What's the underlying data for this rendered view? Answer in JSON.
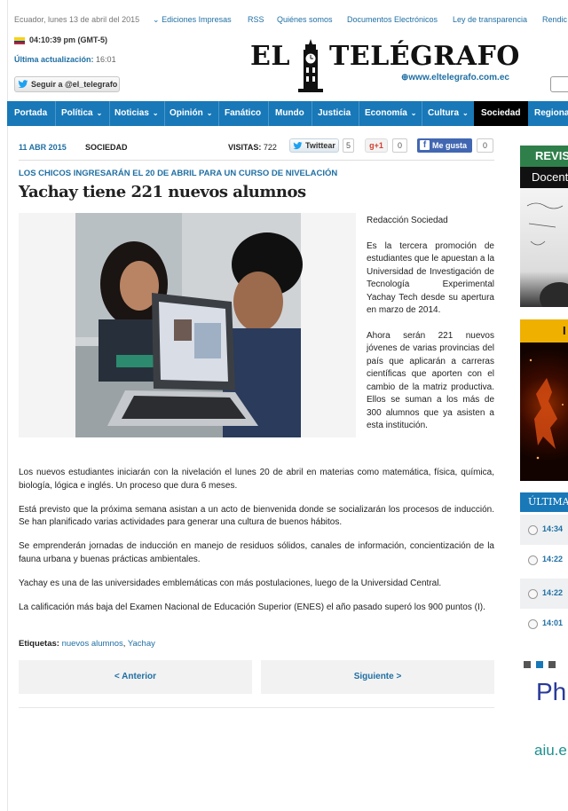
{
  "topbar": {
    "date": "Ecuador, lunes 13 de abril del 2015",
    "links": [
      "Ediciones Impresas",
      "RSS",
      "Quiénes somos",
      "Documentos Electrónicos",
      "Ley de transparencia",
      "Rendic"
    ]
  },
  "header": {
    "time": "04:10:39 pm (GMT-5)",
    "updated_label": "Última actualización:",
    "updated_value": "16:01",
    "follow_label": "Seguir a @el_telegrafo",
    "logo_left": "EL",
    "logo_right": "TELÉGRAFO",
    "logo_url": "www.eltelegrafo.com.ec"
  },
  "nav": {
    "items": [
      {
        "label": "Portada",
        "chevron": false
      },
      {
        "label": "Política",
        "chevron": true
      },
      {
        "label": "Noticias",
        "chevron": true
      },
      {
        "label": "Opinión",
        "chevron": true
      },
      {
        "label": "Fanático",
        "chevron": false
      },
      {
        "label": "Mundo",
        "chevron": false
      },
      {
        "label": "Justicia",
        "chevron": false
      },
      {
        "label": "Economía",
        "chevron": true
      },
      {
        "label": "Cultura",
        "chevron": true
      },
      {
        "label": "Sociedad",
        "chevron": false,
        "active": true
      },
      {
        "label": "Regiona",
        "chevron": false
      }
    ]
  },
  "article": {
    "date": "11 ABR 2015",
    "section": "SOCIEDAD",
    "visits_label": "VISITAS:",
    "visits_value": "722",
    "twitter_label": "Twittear",
    "twitter_count": "5",
    "gplus_label": "+1",
    "gplus_count": "0",
    "fb_label": "Me gusta",
    "fb_count": "0",
    "kicker": "LOS CHICOS INGRESARÁN EL 20 DE ABRIL PARA UN CURSO DE NIVELACIÓN",
    "headline": "Yachay tiene 221 nuevos alumnos",
    "byline": "Redacción Sociedad",
    "side_paragraphs": [
      "Es la tercera promoción de estudiantes que le apuestan a la Universidad de Investigación de Tecnología Experimental Yachay Tech desde su apertura en marzo de 2014.",
      "Ahora serán 221 nuevos jóvenes de varias provincias del país que aplicarán a carreras científicas que aporten con el cambio de la matriz productiva. Ellos se suman a los más de 300 alumnos que ya asisten a esta institución."
    ],
    "paragraphs": [
      "Los nuevos estudiantes iniciarán con la nivelación el lunes 20 de abril en materias como matemática, física, química, biología, lógica e inglés. Un proceso que dura 6 meses.",
      "Está previsto que la próxima semana asistan a un acto de bienvenida donde se socializarán los procesos de inducción. Se han planificado varias actividades para generar una cultura de buenos hábitos.",
      "Se emprenderán jornadas de inducción en manejo de residuos sólidos, canales de información, concientización de la fauna urbana y buenas prácticas ambientales.",
      "Yachay es una de las universidades emblemáticas con más postulaciones, luego de la Universidad Central.",
      "La calificación más baja del Examen Nacional de Educación Superior (ENES) el año pasado superó los 900 puntos (I)."
    ],
    "tags_label": "Etiquetas:",
    "tag1": "nuevos alumnos",
    "tag_sep": ",",
    "tag2": "Yachay",
    "prev_label": "< Anterior",
    "next_label": "Siguiente >"
  },
  "sidebar": {
    "ad1_head": "REVIS",
    "ad1_sub": "Docent",
    "ad2_head": "I",
    "ultimas_title": "ÚLTIMA",
    "ultimas_times": [
      "14:34",
      "14:22",
      "14:22",
      "14:01"
    ],
    "ad3_text": "Ph",
    "ad3_url": "aiu.e"
  },
  "colors": {
    "nav_bg": "#1878b8",
    "link": "#1f6fa3",
    "active_tab": "#000000"
  }
}
